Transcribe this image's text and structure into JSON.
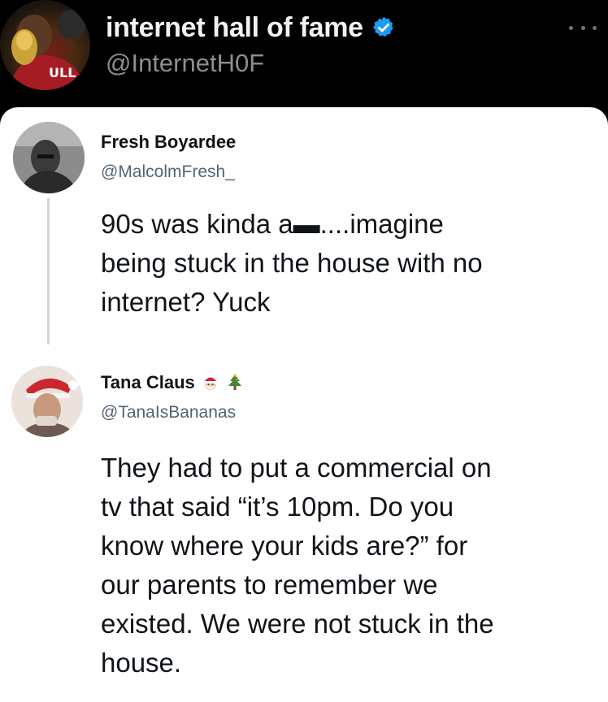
{
  "post": {
    "author_name": "internet hall of fame",
    "author_handle": "@InternetH0F",
    "verified_color": "#1d9bf0",
    "more_icon": "more-horizontal-icon"
  },
  "screenshot": {
    "tweets": [
      {
        "name": "Fresh Boyardee",
        "handle": "@MalcolmFresh_",
        "text_lines": [
          "90s was kinda a▬....imagine",
          "being stuck in the house with no",
          "internet? Yuck"
        ]
      },
      {
        "name": "Tana Claus",
        "name_emojis": [
          "santa-face-icon",
          "christmas-tree-icon"
        ],
        "handle": "@TanaIsBananas",
        "text_lines": [
          "They had to put a commercial on",
          "tv that said “it’s 10pm. Do you",
          "know where your kids are?” for",
          "our parents to remember we",
          "existed. We were not stuck in the",
          "house."
        ]
      }
    ]
  }
}
